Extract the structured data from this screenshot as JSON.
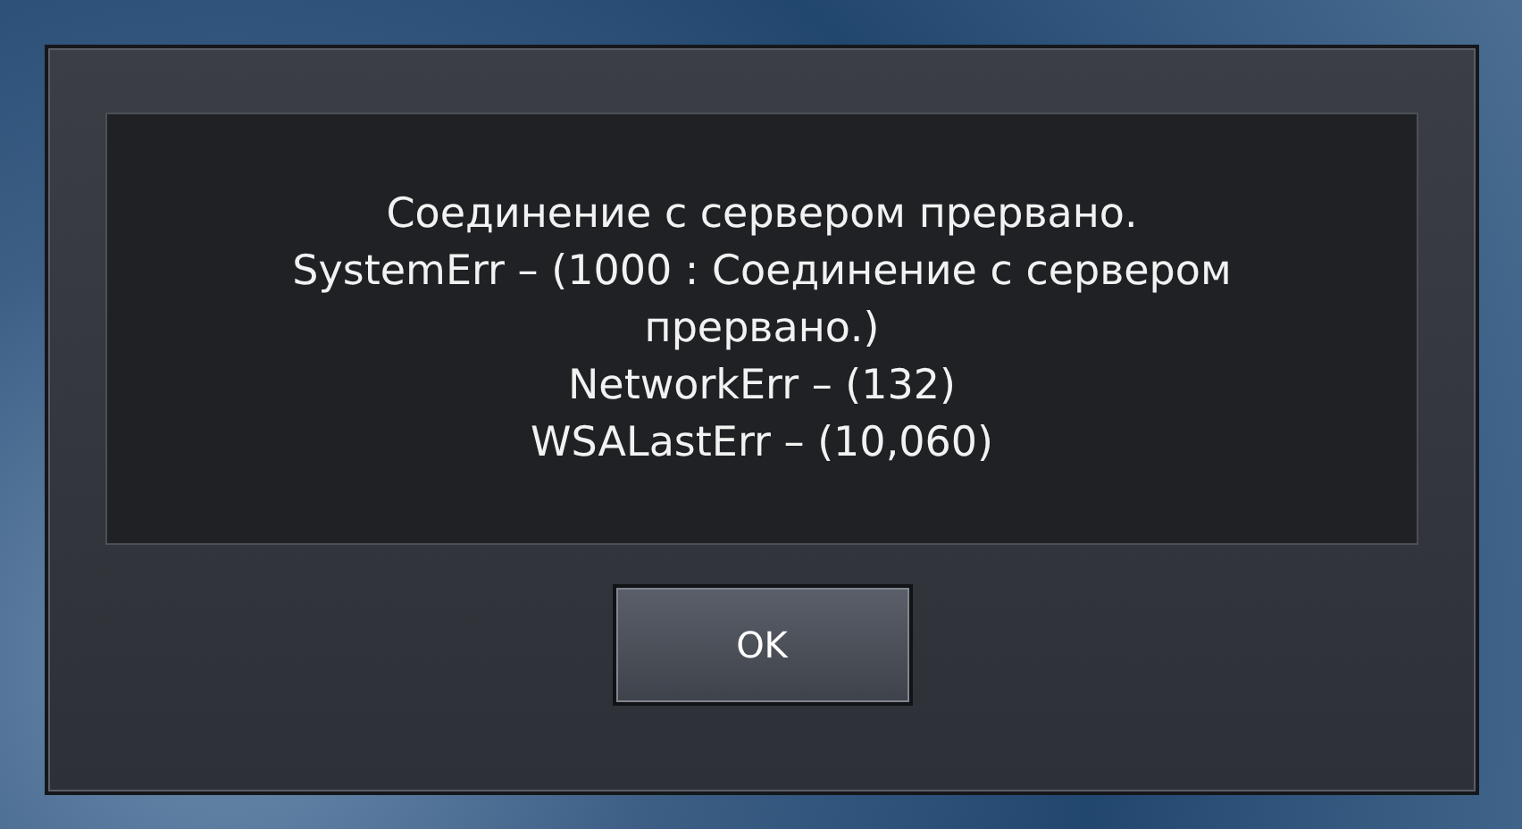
{
  "dialog": {
    "message_lines": [
      "Соединение с сервером прервано.",
      "SystemErr – (1000 : Соединение с сервером прервано.)",
      "NetworkErr – (132)",
      "WSALastErr – (10,060)"
    ],
    "buttons": [
      "OK"
    ]
  }
}
